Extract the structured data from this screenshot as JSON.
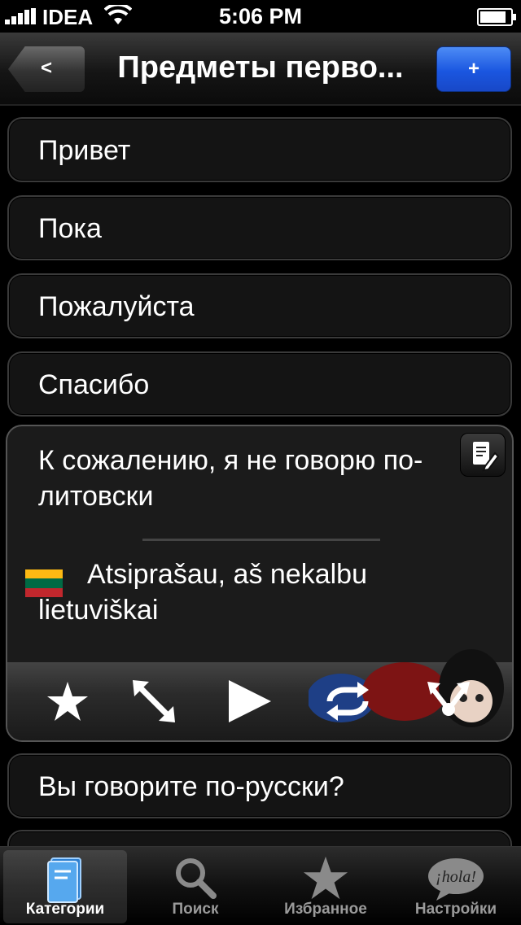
{
  "status": {
    "carrier": "IDEA",
    "time": "5:06 PM",
    "battery_level": 0.85
  },
  "nav": {
    "back_label": "<",
    "title": "Предметы перво...",
    "add_label": "+"
  },
  "phrases": [
    {
      "text": "Привет"
    },
    {
      "text": "Пока"
    },
    {
      "text": "Пожалуйста"
    },
    {
      "text": "Спасибо"
    }
  ],
  "expanded": {
    "source": "К сожалению, я не говорю по-литовски",
    "translation": "Atsiprašau, aš nekalbu lietuviškai",
    "flag_colors": [
      "#fdb913",
      "#006a44",
      "#c1272d"
    ],
    "actions": [
      "star-icon",
      "expand-arrows-icon",
      "play-icon",
      "repeat-icon",
      "share-icon"
    ]
  },
  "phrases_after": [
    {
      "text": "Вы говорите по-русски?"
    }
  ],
  "tabs": [
    {
      "label": "Категории",
      "icon": "book-icon",
      "active": true
    },
    {
      "label": "Поиск",
      "icon": "search-icon",
      "active": false
    },
    {
      "label": "Избранное",
      "icon": "star-icon",
      "active": false
    },
    {
      "label": "Настройки",
      "icon": "hola-bubble-icon",
      "active": false
    }
  ],
  "colors": {
    "accent_blue": "#1a56e0",
    "background": "#000000"
  }
}
